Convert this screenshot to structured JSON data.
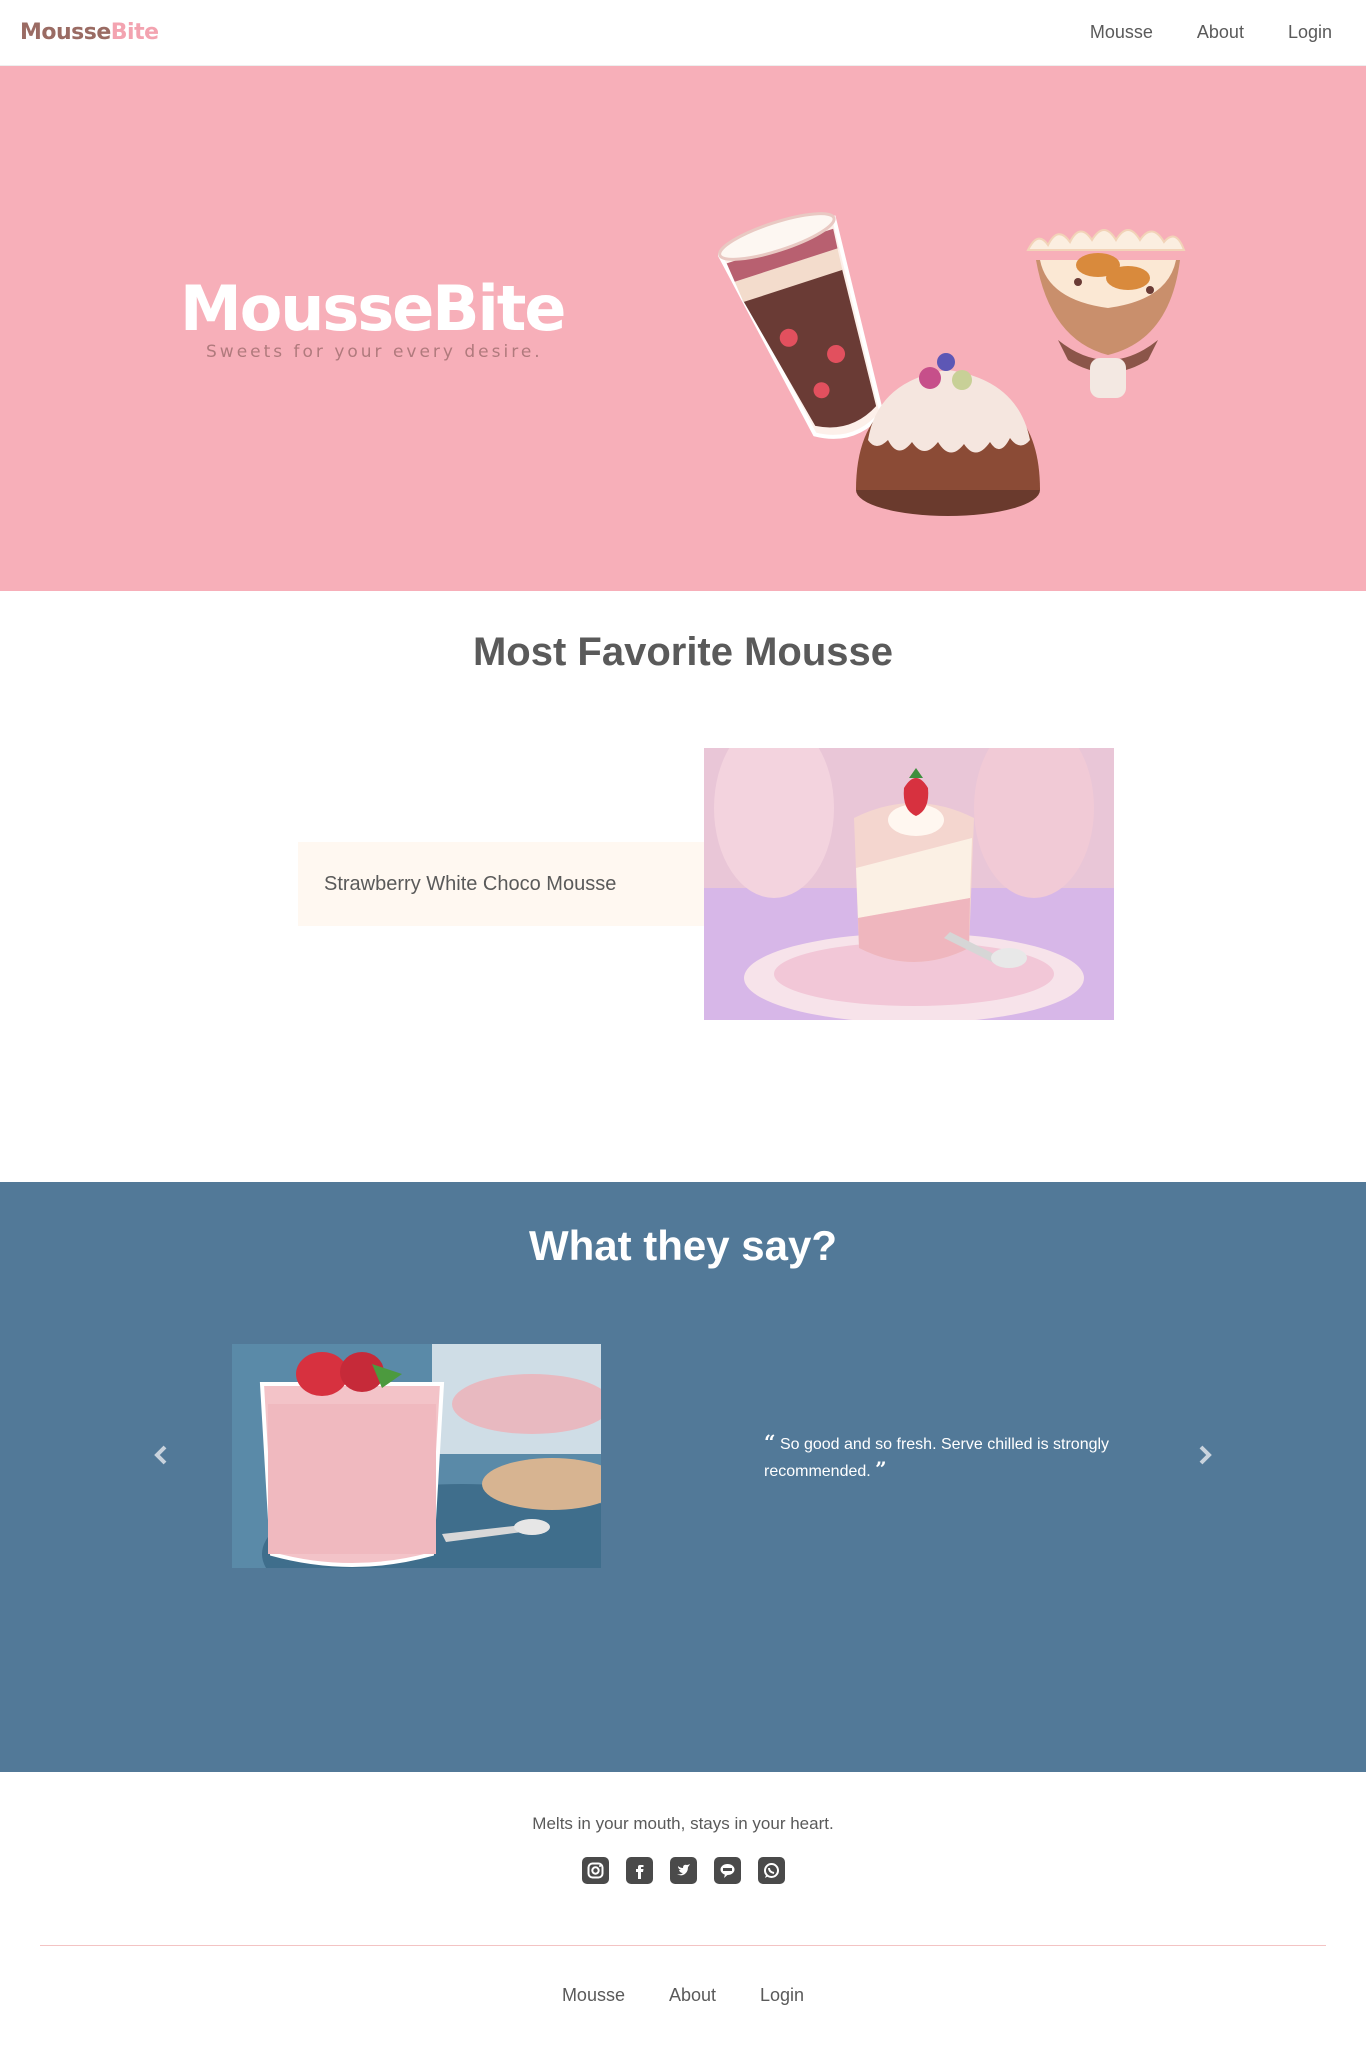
{
  "navbar": {
    "brand_part1": "Mousse",
    "brand_part2": "Bite",
    "links": [
      "Mousse",
      "About",
      "Login"
    ]
  },
  "hero": {
    "title": "MousseBite",
    "subtitle": "Sweets for your every desire."
  },
  "favorite": {
    "title": "Most Favorite Mousse",
    "item_name": "Strawberry White Choco Mousse"
  },
  "testimonials": {
    "title": "What they say?",
    "quote": "So good and so fresh. Serve chilled is strongly recommended.",
    "open_quote": "“",
    "close_quote": "”"
  },
  "footer": {
    "tagline": "Melts in your mouth, stays in your heart.",
    "socials": [
      "instagram-icon",
      "facebook-icon",
      "twitter-icon",
      "line-icon",
      "whatsapp-icon"
    ],
    "links": [
      "Mousse",
      "About",
      "Login"
    ]
  },
  "colors": {
    "hero_bg": "#f7afb9",
    "testimonial_bg": "#527998",
    "card_bg": "#fff8f1",
    "brand_brown": "#9a6b63",
    "brand_pink": "#f3a3b0"
  }
}
